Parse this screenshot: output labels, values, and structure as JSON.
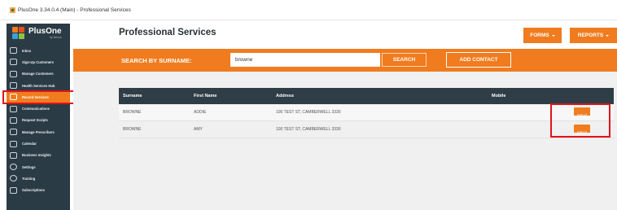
{
  "window": {
    "title": "PlusOne 3.34.0.4 (Main) - Professional Services"
  },
  "logo": {
    "name": "PlusOne",
    "sub": "by Nexus"
  },
  "sidebar": {
    "items": [
      {
        "label": "Inbox",
        "icon": "inbox-icon",
        "active": false
      },
      {
        "label": "Sign-Up Customers",
        "icon": "add-user-icon",
        "active": false
      },
      {
        "label": "Manage Customers",
        "icon": "users-icon",
        "active": false
      },
      {
        "label": "Health Services Hub",
        "icon": "health-icon",
        "active": false
      },
      {
        "label": "Record Services",
        "icon": "clipboard-icon",
        "active": true
      },
      {
        "label": "Communications",
        "icon": "chat-icon",
        "active": false
      },
      {
        "label": "Request Scripts",
        "icon": "person-icon",
        "active": false
      },
      {
        "label": "Manage Prescribers",
        "icon": "building-icon",
        "active": false
      },
      {
        "label": "Calendar",
        "icon": "calendar-icon",
        "active": false
      },
      {
        "label": "Business Insights",
        "icon": "report-icon",
        "active": false
      },
      {
        "label": "Settings",
        "icon": "gear-icon",
        "active": false
      },
      {
        "label": "Training",
        "icon": "help-icon",
        "active": false
      },
      {
        "label": "Subscriptions",
        "icon": "card-icon",
        "active": false
      }
    ]
  },
  "header": {
    "title": "Professional Services",
    "forms_label": "FORMS",
    "reports_label": "REPORTS"
  },
  "search": {
    "label": "SEARCH BY SURNAME:",
    "value": "browne",
    "button_label": "SEARCH",
    "add_contact_label": "ADD CONTACT"
  },
  "table": {
    "columns": [
      "Surname",
      "First Name",
      "Address",
      "Mobile"
    ],
    "rows": [
      {
        "surname": "BROWNE",
        "first_name": "ADDIE",
        "address": "100 TEST ST, CAMBERWELL 3330",
        "mobile": "",
        "action": "Select"
      },
      {
        "surname": "BROWNE",
        "first_name": "AMY",
        "address": "100 TEST ST, CAMBERWELL 3330",
        "mobile": "",
        "action": "Select"
      }
    ]
  },
  "colors": {
    "accent": "#f07c1f",
    "sidebar": "#2b3b46",
    "table_header": "#2f3d47",
    "highlight": "#e0141a"
  }
}
